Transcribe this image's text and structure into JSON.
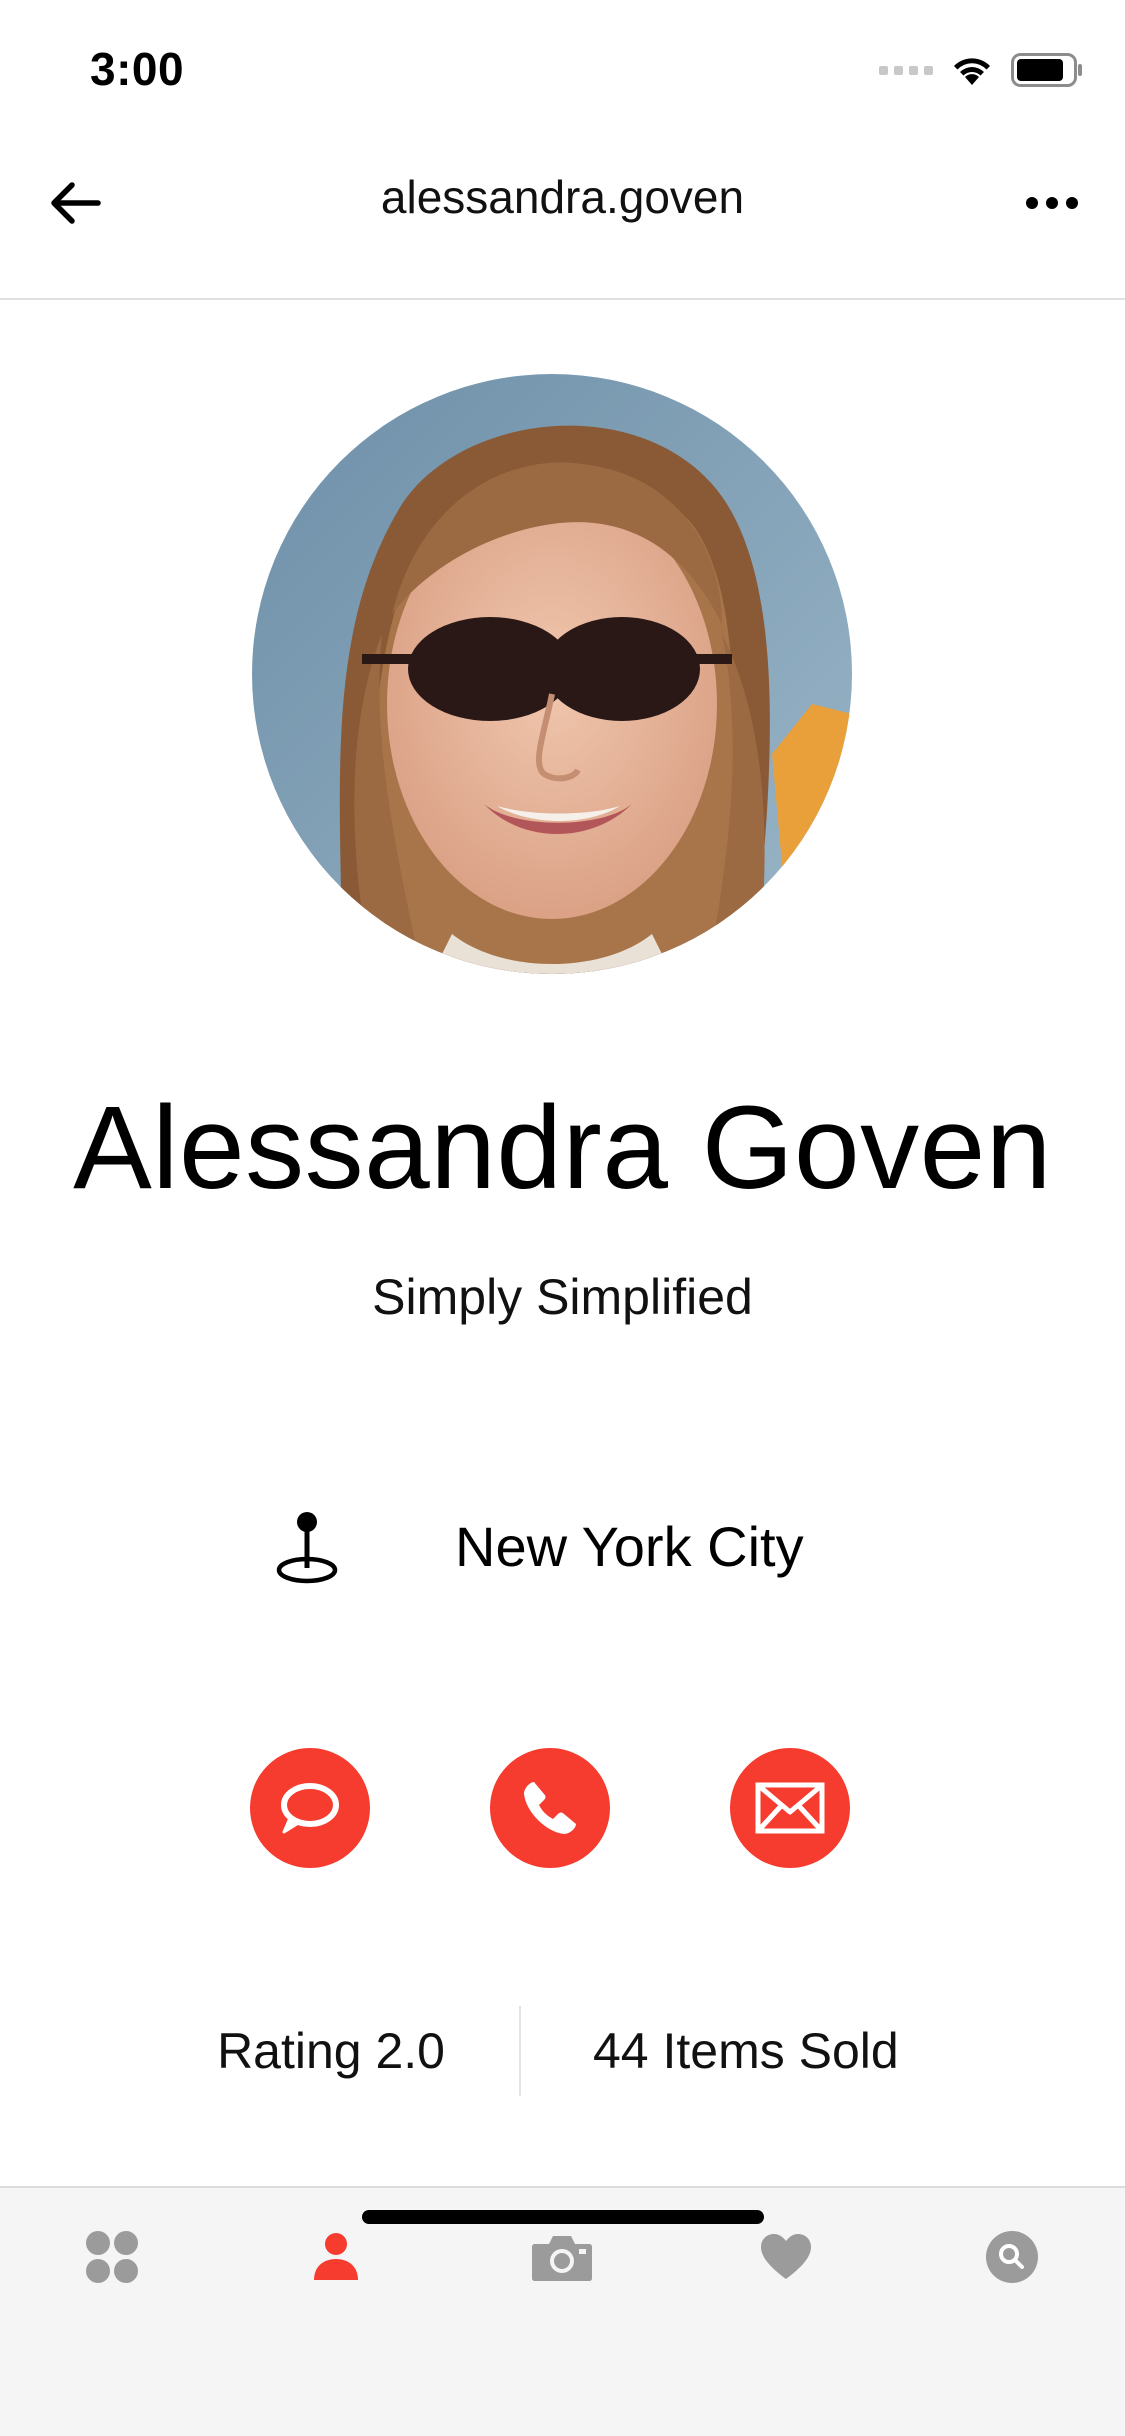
{
  "status_bar": {
    "time": "3:00"
  },
  "header": {
    "title": "alessandra.goven"
  },
  "profile": {
    "name": "Alessandra Goven",
    "tagline": "Simply Simplified",
    "location": "New York City"
  },
  "stats": {
    "rating": "Rating 2.0",
    "items_sold": "44 Items Sold"
  },
  "colors": {
    "accent": "#f63b2f",
    "tab_inactive": "#9b9b9b",
    "tab_bar_bg": "#f5f5f5"
  },
  "icons": {
    "back": "arrow-left-icon",
    "more": "more-dots-icon",
    "location": "map-pin-icon",
    "message": "chat-bubble-icon",
    "call": "phone-icon",
    "mail": "envelope-icon",
    "tabs": [
      "grid-icon",
      "profile-icon",
      "camera-icon",
      "heart-icon",
      "search-icon"
    ]
  },
  "tab_bar": {
    "active_index": 1
  }
}
